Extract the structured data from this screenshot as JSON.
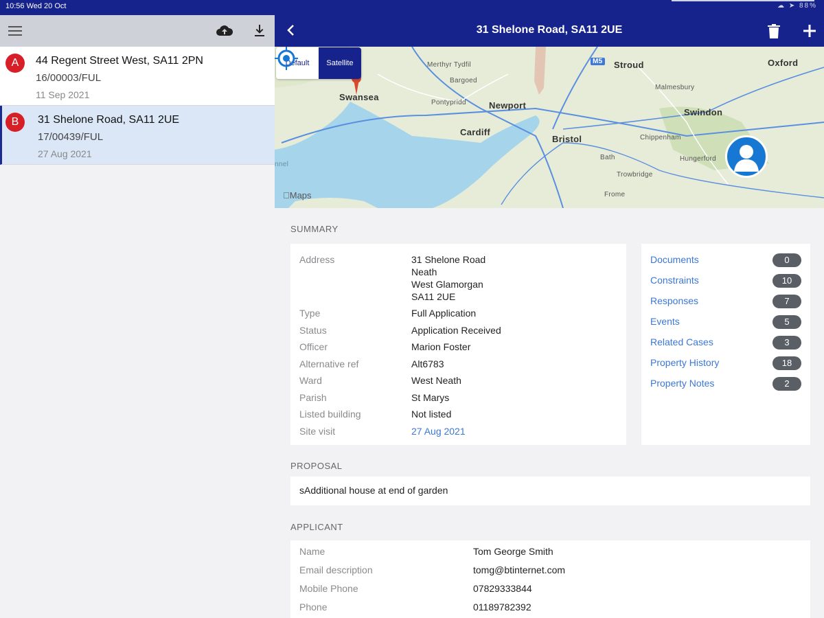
{
  "status_bar": {
    "time": "10:56   Wed 20 Oct",
    "right": "☁  ➤ 88%"
  },
  "left_toolbar": {
    "icons": [
      "menu-icon",
      "cloud-upload-icon",
      "download-icon"
    ]
  },
  "cases": [
    {
      "badge": "A",
      "address": "44 Regent Street West, SA11 2PN",
      "ref": "16/00003/FUL",
      "date": "11 Sep 2021",
      "selected": false
    },
    {
      "badge": "B",
      "address": "31 Shelone Road, SA11 2UE",
      "ref": "17/00439/FUL",
      "date": "27 Aug 2021",
      "selected": true
    }
  ],
  "header": {
    "title": "31 Shelone Road, SA11 2UE"
  },
  "map": {
    "segment": {
      "default": "Default",
      "satellite": "Satellite"
    },
    "attribution": "Maps",
    "labels": {
      "swansea": "Swansea",
      "cardiff": "Cardiff",
      "newport": "Newport",
      "bristol": "Bristol",
      "stroud": "Stroud",
      "swindon": "Swindon",
      "oxford": "Oxford",
      "merthyr": "Merthyr Tydfil",
      "chippenham": "Chippenham",
      "malmesbury": "Malmesbury",
      "bath": "Bath",
      "frome": "Frome",
      "trowbridge": "Trowbridge",
      "pontypridd": "Pontypridd",
      "bargoed": "Bargoed",
      "hungerford": "Hungerford",
      "m5": "M5",
      "channel": "nnel"
    }
  },
  "summary": {
    "title": "SUMMARY",
    "rows": [
      {
        "label": "Address",
        "value_lines": [
          "31 Shelone Road",
          "Neath",
          "West Glamorgan",
          "SA11 2UE"
        ]
      },
      {
        "label": "Type",
        "value": "Full Application"
      },
      {
        "label": "Status",
        "value": "Application Received"
      },
      {
        "label": "Officer",
        "value": "Marion Foster"
      },
      {
        "label": "Alternative ref",
        "value": "Alt6783"
      },
      {
        "label": "Ward",
        "value": "West Neath"
      },
      {
        "label": "Parish",
        "value": "St Marys"
      },
      {
        "label": "Listed building",
        "value": "Not listed"
      },
      {
        "label": "Site visit",
        "value": "27 Aug 2021"
      }
    ],
    "links": [
      {
        "label": "Documents",
        "count": "0"
      },
      {
        "label": "Constraints",
        "count": "10"
      },
      {
        "label": "Responses",
        "count": "7"
      },
      {
        "label": "Events",
        "count": "5"
      },
      {
        "label": "Related Cases",
        "count": "3"
      },
      {
        "label": "Property History",
        "count": "18"
      },
      {
        "label": "Property Notes",
        "count": "2"
      }
    ]
  },
  "proposal": {
    "title": "PROPOSAL",
    "text": "sAdditional house at end of garden"
  },
  "applicant": {
    "title": "APPLICANT",
    "rows": [
      {
        "label": "Name",
        "value": "Tom George Smith"
      },
      {
        "label": "Email description",
        "value": "tomg@btinternet.com"
      },
      {
        "label": "Mobile Phone",
        "value": "07829333844"
      },
      {
        "label": "Phone",
        "value": "01189782392"
      }
    ]
  },
  "colors": {
    "header": "#16238c",
    "badge": "#d71f28",
    "link": "#3b77d8",
    "selected": "#dbe7f7"
  }
}
